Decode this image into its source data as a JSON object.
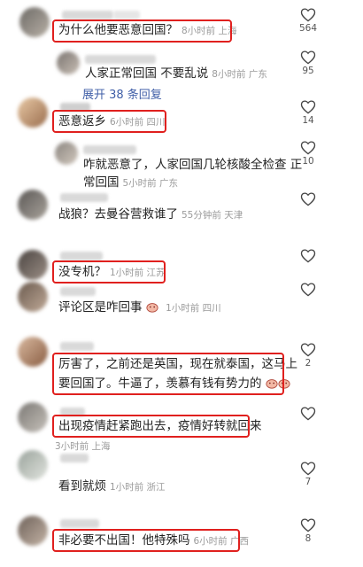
{
  "comments": [
    {
      "text": "为什么他要恶意回国？",
      "time": "8小时前",
      "loc": "上海",
      "likes": "564"
    },
    {
      "text": "人家正常回国  不要乱说",
      "time": "8小时前",
      "loc": "广东",
      "likes": "95",
      "reply": true
    },
    {
      "expand": "展开 38 条回复"
    },
    {
      "text": "恶意返乡",
      "time": "6小时前",
      "loc": "四川",
      "likes": "14"
    },
    {
      "text_line1": "咋就恶意了，人家回国几轮核酸全检查 正",
      "text_line2": "常回国",
      "time": "5小时前",
      "loc": "广东",
      "likes": "10",
      "reply": true
    },
    {
      "text": "战狼？去曼谷营救谁了",
      "time": "55分钟前",
      "loc": "天津",
      "likes": ""
    },
    {
      "text": "没专机？",
      "time": "1小时前",
      "loc": "江苏",
      "likes": ""
    },
    {
      "text": "评论区是咋回事",
      "time": "1小时前",
      "loc": "四川",
      "likes": ""
    },
    {
      "text_line1": "厉害了，之前还是英国，现在就泰国，这马上",
      "text_line2": "要回国了。牛逼了，羡慕有钱有势力的",
      "likes": "2"
    },
    {
      "text": "出现疫情赶紧跑出去，疫情好转就回来",
      "time": "3小时前",
      "loc": "上海",
      "likes": ""
    },
    {
      "text": "看到就烦",
      "time": "1小时前",
      "loc": "浙江",
      "likes": "7"
    },
    {
      "text": "非必要不出国！他特殊吗",
      "time": "6小时前",
      "loc": "广西",
      "likes": "8"
    }
  ]
}
